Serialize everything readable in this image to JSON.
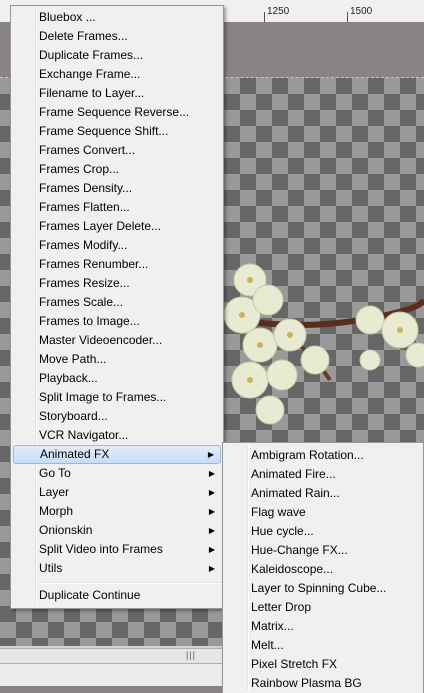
{
  "ruler": {
    "labels": [
      "1250",
      "1500"
    ]
  },
  "main_menu": {
    "items": [
      {
        "label": "Bluebox ...",
        "submenu": false
      },
      {
        "label": "Delete Frames...",
        "submenu": false
      },
      {
        "label": "Duplicate Frames...",
        "submenu": false
      },
      {
        "label": "Exchange Frame...",
        "submenu": false
      },
      {
        "label": "Filename to Layer...",
        "submenu": false
      },
      {
        "label": "Frame Sequence Reverse...",
        "submenu": false
      },
      {
        "label": "Frame Sequence Shift...",
        "submenu": false
      },
      {
        "label": "Frames Convert...",
        "submenu": false
      },
      {
        "label": "Frames Crop...",
        "submenu": false
      },
      {
        "label": "Frames Density...",
        "submenu": false
      },
      {
        "label": "Frames Flatten...",
        "submenu": false
      },
      {
        "label": "Frames Layer Delete...",
        "submenu": false
      },
      {
        "label": "Frames Modify...",
        "submenu": false
      },
      {
        "label": "Frames Renumber...",
        "submenu": false
      },
      {
        "label": "Frames Resize...",
        "submenu": false
      },
      {
        "label": "Frames Scale...",
        "submenu": false
      },
      {
        "label": "Frames to Image...",
        "submenu": false
      },
      {
        "label": "Master Videoencoder...",
        "submenu": false
      },
      {
        "label": "Move Path...",
        "submenu": false
      },
      {
        "label": "Playback...",
        "submenu": false
      },
      {
        "label": "Split Image to Frames...",
        "submenu": false
      },
      {
        "label": "Storyboard...",
        "submenu": false
      },
      {
        "label": "VCR Navigator...",
        "submenu": false
      },
      {
        "label": "Animated FX",
        "submenu": true,
        "highlighted": true
      },
      {
        "label": "Go To",
        "submenu": true
      },
      {
        "label": "Layer",
        "submenu": true
      },
      {
        "label": "Morph",
        "submenu": true
      },
      {
        "label": "Onionskin",
        "submenu": true
      },
      {
        "label": "Split Video into Frames",
        "submenu": true
      },
      {
        "label": "Utils",
        "submenu": true
      }
    ],
    "footer_item": "Duplicate Continue",
    "submenu_arrow": "▶"
  },
  "sub_menu": {
    "items": [
      "Ambigram Rotation...",
      "Animated Fire...",
      "Animated Rain...",
      "Flag wave",
      "Hue cycle...",
      "Hue-Change FX...",
      "Kaleidoscope...",
      "Layer to Spinning Cube...",
      "Letter Drop",
      "Matrix...",
      "Melt...",
      "Pixel Stretch FX",
      "Rainbow Plasma BG"
    ]
  },
  "scrollbar": {
    "grip": "|||"
  },
  "colors": {
    "menu_bg": "#f0f0f0",
    "highlight": "#c6dcf5",
    "canvas_bg": "#8a8385"
  }
}
